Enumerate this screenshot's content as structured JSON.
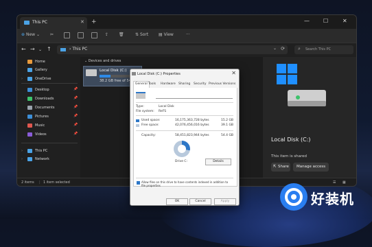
{
  "window": {
    "tab_title": "This PC",
    "tab_close": "✕",
    "new_tab": "+",
    "controls": {
      "minimize": "—",
      "maximize": "☐",
      "close": "✕"
    }
  },
  "toolbar": {
    "new_label": "New",
    "new_arrow": "⌄",
    "sort_label": "Sort",
    "view_label": "View",
    "more": "···"
  },
  "address": {
    "back": "←",
    "forward": "→",
    "down": "⌄",
    "up": "↑",
    "path": "This PC",
    "path_chevron": "›",
    "dropdown": "⌄",
    "refresh": "⟳",
    "search_icon": "⌕",
    "search_placeholder": "Search This PC"
  },
  "sidebar": {
    "items": [
      {
        "label": "Home",
        "color": "#e89a3c",
        "arrow": "",
        "pin": ""
      },
      {
        "label": "Gallery",
        "color": "#4ba3e6",
        "arrow": "",
        "pin": ""
      },
      {
        "label": "OneDrive",
        "color": "#4ba3e6",
        "arrow": "›",
        "pin": ""
      },
      {
        "label": "Desktop",
        "color": "#3d8fd8",
        "arrow": "",
        "pin": "📌"
      },
      {
        "label": "Downloads",
        "color": "#3ec26b",
        "arrow": "",
        "pin": "📌"
      },
      {
        "label": "Documents",
        "color": "#9aa3ad",
        "arrow": "",
        "pin": "📌"
      },
      {
        "label": "Pictures",
        "color": "#3d8fd8",
        "arrow": "",
        "pin": "📌"
      },
      {
        "label": "Music",
        "color": "#e0574f",
        "arrow": "",
        "pin": "📌"
      },
      {
        "label": "Videos",
        "color": "#8a5cd8",
        "arrow": "",
        "pin": "📌"
      },
      {
        "label": "This PC",
        "color": "#4ba3e6",
        "arrow": "›",
        "pin": ""
      },
      {
        "label": "Network",
        "color": "#4ba3e6",
        "arrow": "›",
        "pin": ""
      }
    ]
  },
  "content": {
    "section_title": "Devices and drives",
    "drive": {
      "name": "Local Disk (C:)",
      "free_text": "38.2 GB free of 54.4 GB",
      "used_fraction": 0.28
    }
  },
  "preview": {
    "title": "Local Disk (C:)",
    "shared_text": "This item is shared",
    "share_button": "Share",
    "manage_button": "Manage access"
  },
  "statusbar": {
    "items_count": "2 items",
    "selected": "1 item selected"
  },
  "dialog": {
    "title": "Local Disk (C:) Properties",
    "close": "✕",
    "tabs": [
      "General",
      "Tools",
      "Hardware",
      "Sharing",
      "Security",
      "Previous Versions"
    ],
    "type_label": "Type:",
    "type_value": "Local Disk",
    "fs_label": "File system:",
    "fs_value": "ReFS",
    "used_label": "Used space:",
    "used_bytes": "16,175,363,728 bytes",
    "used_gb": "15.2 GB",
    "free_label": "Free space:",
    "free_bytes": "42,076,456,016 bytes",
    "free_gb": "39.1 GB",
    "capacity_label": "Capacity:",
    "capacity_bytes": "58,451,823,944 bytes",
    "capacity_gb": "54.4 GB",
    "drive_label": "Drive C:",
    "details_button": "Details",
    "allow_index_text": "Allow files on this drive to have contents indexed in addition to file properties",
    "ok": "OK",
    "cancel": "Cancel",
    "apply": "Apply",
    "colors": {
      "used": "#2d77c7",
      "free": "#b8c9dc"
    }
  },
  "watermark": {
    "text": "好装机"
  }
}
